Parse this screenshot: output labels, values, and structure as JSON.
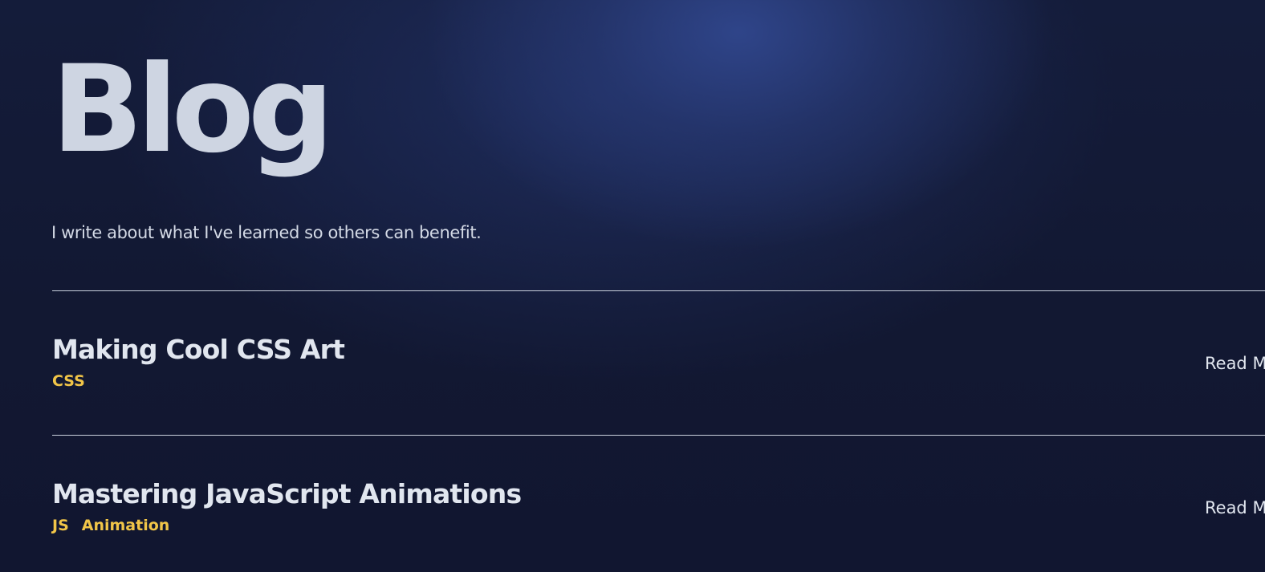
{
  "header": {
    "title": "Blog",
    "subtitle": "I write about what I've learned so others can benefit."
  },
  "posts": [
    {
      "title": "Making Cool CSS Art",
      "tags": [
        "CSS"
      ],
      "read_more_label": "Read More"
    },
    {
      "title": "Mastering JavaScript Animations",
      "tags": [
        "JS",
        "Animation"
      ],
      "read_more_label": "Read More"
    }
  ],
  "colors": {
    "background": "#121830",
    "glow": "#30468c",
    "heading": "#ced5e2",
    "tag": "#f1c548",
    "divider": "#c9d0dc"
  }
}
